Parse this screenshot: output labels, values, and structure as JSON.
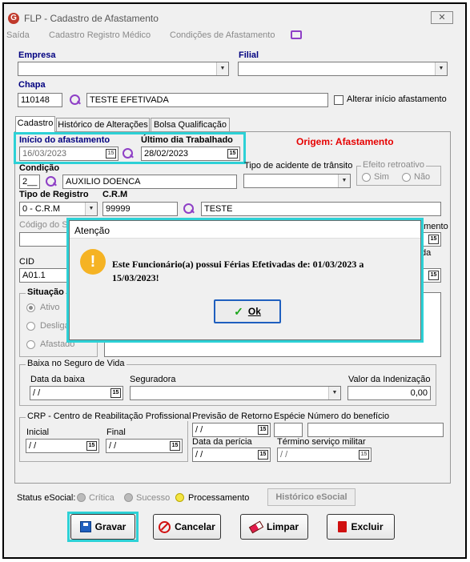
{
  "window": {
    "title": "FLP - Cadastro de Afastamento",
    "close": "✕"
  },
  "menu": [
    "Saída",
    "Cadastro Registro Médico",
    "Condições de Afastamento"
  ],
  "empresa": {
    "label": "Empresa",
    "value": ""
  },
  "filial": {
    "label": "Filial",
    "value": ""
  },
  "chapa": {
    "label": "Chapa",
    "value": "110148",
    "name": "TESTE EFETIVADA"
  },
  "alterar": {
    "label": "Alterar início afastamento",
    "checked": false
  },
  "tabs": [
    "Cadastro",
    "Histórico de Alterações",
    "Bolsa Qualificação"
  ],
  "inicio": {
    "label": "Início do afastamento",
    "value": "16/03/2023"
  },
  "ultimo": {
    "label": "Último dia Trabalhado",
    "value": "28/02/2023"
  },
  "origem": "Origem: Afastamento",
  "condicao": {
    "label": "Condição",
    "code": "2__",
    "desc": "AUXILIO DOENCA"
  },
  "tipoAcidente": {
    "label": "Tipo de acidente de trânsito",
    "value": ""
  },
  "efeito": {
    "label": "Efeito retroativo",
    "sim": "Sim",
    "nao": "Não"
  },
  "tipoRegistro": {
    "label": "Tipo de Registro",
    "value": "0 - C.R.M"
  },
  "crm": {
    "label": "C.R.M",
    "value": "99999",
    "name": "TESTE"
  },
  "codigoSi": "Código do Si",
  "cid": {
    "label": "CID",
    "value": "A01.1"
  },
  "situacao": {
    "label": "Situação",
    "opts": [
      "Ativo",
      "Desligado",
      "Afastado"
    ]
  },
  "partial": {
    "amento": "amento",
    "da": "da"
  },
  "baixa": {
    "label": "Baixa no Seguro de Vida",
    "data_label": "Data da baixa",
    "data": "/ /",
    "seguradora_label": "Seguradora",
    "valor_label": "Valor da Indenização",
    "valor": "0,00"
  },
  "crp": {
    "label": "CRP - Centro de Reabilitação Profissional",
    "inicial_label": "Inicial",
    "inicial": "/ /",
    "final_label": "Final",
    "final": "/ /"
  },
  "prev": {
    "label": "Previsão de Retorno",
    "value": "/ /"
  },
  "especie": {
    "label": "Espécie",
    "value": ""
  },
  "beneficio": {
    "label": "Número do benefício",
    "value": ""
  },
  "pericia": {
    "label": "Data da perícia",
    "value": "/ /"
  },
  "militar": {
    "label": "Término serviço militar",
    "value": "/ /"
  },
  "status": {
    "label": "Status eSocial:",
    "critica": "Crítica",
    "sucesso": "Sucesso",
    "proc": "Processamento",
    "hist": "Histórico eSocial"
  },
  "buttons": {
    "gravar": "Gravar",
    "cancelar": "Cancelar",
    "limpar": "Limpar",
    "excluir": "Excluir"
  },
  "cal": "15",
  "dialog": {
    "title": "Atenção",
    "message": "Este Funcionário(a) possui Férias Efetivadas de: 01/03/2023 a 15/03/2023!",
    "ok": "Ok",
    "icon": "!"
  },
  "colors": {
    "highlight": "#2dd1d6",
    "origem": "#e60000",
    "label_blue": "#000080",
    "warn": "#f5b324"
  }
}
